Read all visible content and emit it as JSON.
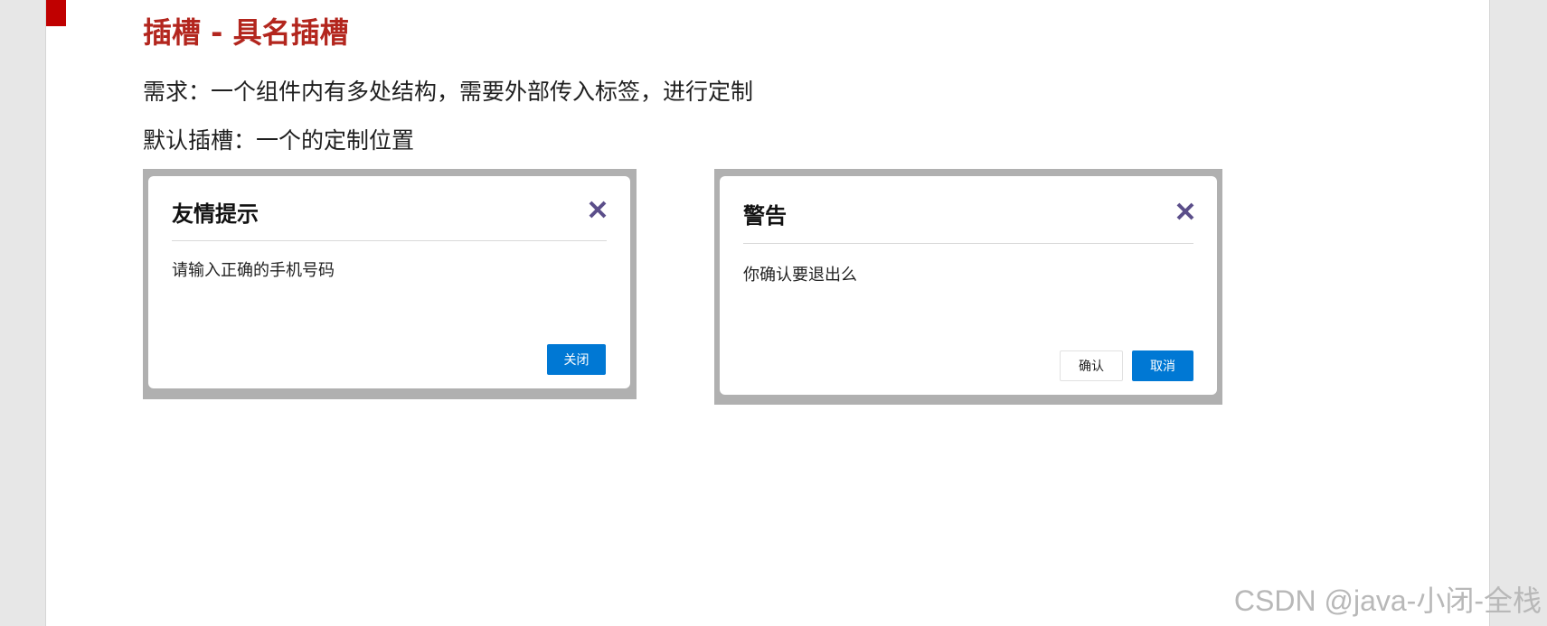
{
  "slide": {
    "title": "插槽 - 具名插槽",
    "lines": [
      "需求：一个组件内有多处结构，需要外部传入标签，进行定制",
      "默认插槽：一个的定制位置"
    ]
  },
  "dialogs": [
    {
      "title": "友情提示",
      "close_icon": "close-icon",
      "body": "请输入正确的手机号码",
      "buttons": [
        {
          "label": "关闭",
          "style": "primary"
        }
      ]
    },
    {
      "title": "警告",
      "close_icon": "close-icon",
      "body": "你确认要退出么",
      "buttons": [
        {
          "label": "确认",
          "style": "default"
        },
        {
          "label": "取消",
          "style": "primary"
        }
      ]
    }
  ],
  "colors": {
    "title": "#b3261e",
    "primary_button": "#0078d4",
    "close_icon": "#5b4e8a",
    "corner_mark": "#c00000"
  },
  "watermark": "CSDN @java-小闭-全栈"
}
